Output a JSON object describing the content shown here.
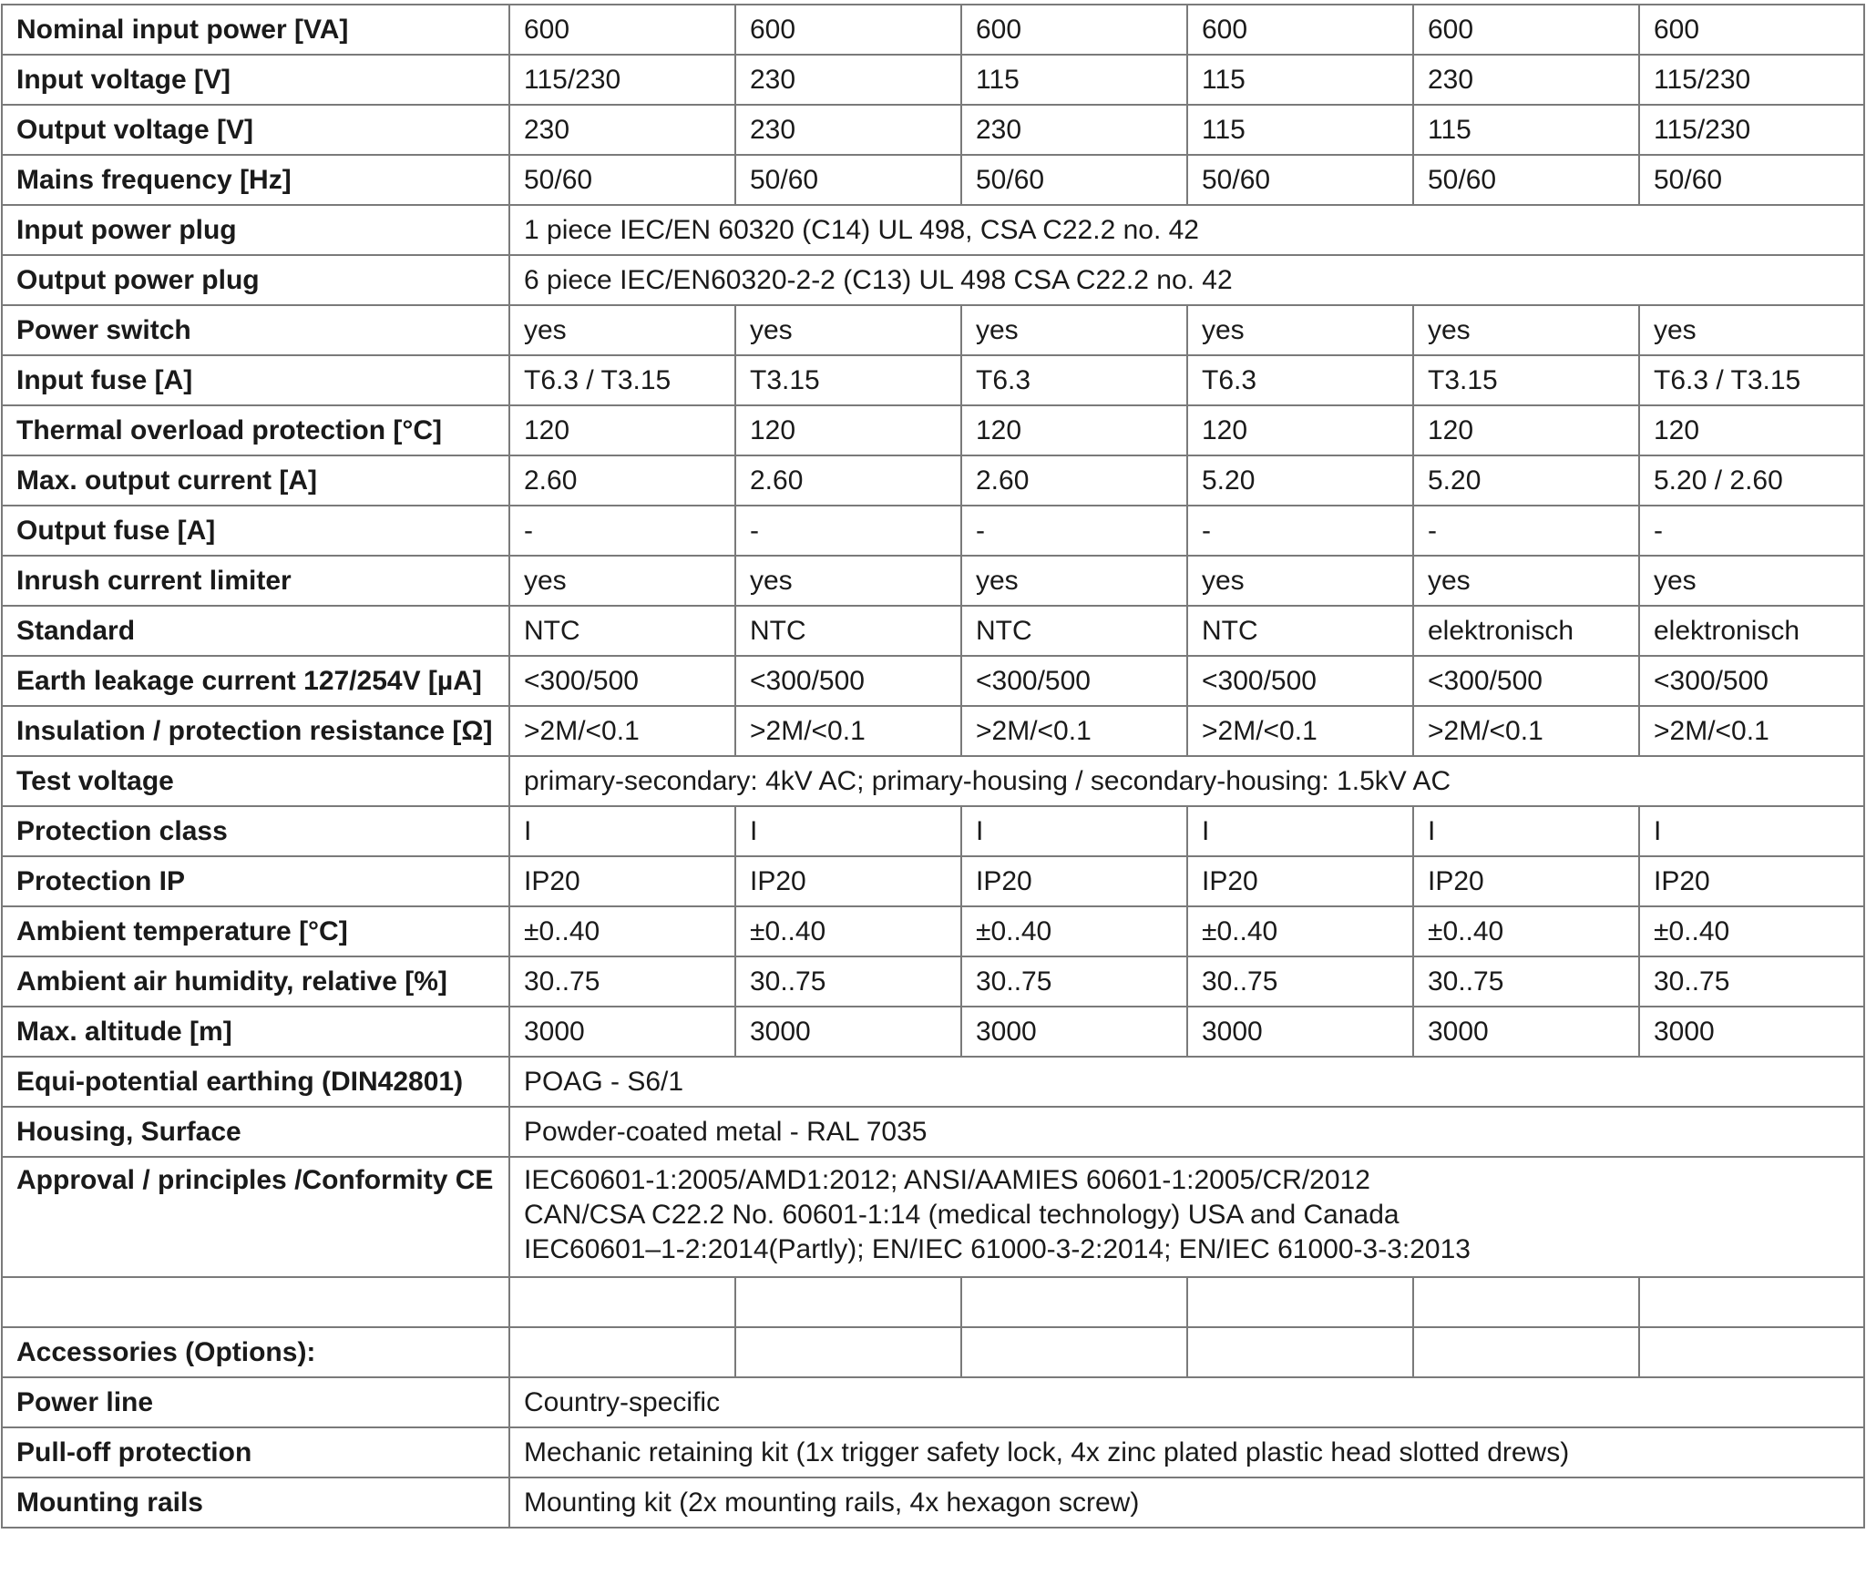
{
  "rows": [
    {
      "label": "Nominal input power [VA]",
      "cells": [
        "600",
        "600",
        "600",
        "600",
        "600",
        "600"
      ]
    },
    {
      "label": "Input voltage [V]",
      "cells": [
        "115/230",
        "230",
        "115",
        "115",
        "230",
        "115/230"
      ]
    },
    {
      "label": "Output voltage [V]",
      "cells": [
        "230",
        "230",
        "230",
        "115",
        "115",
        "115/230"
      ]
    },
    {
      "label": "Mains frequency [Hz]",
      "cells": [
        "50/60",
        "50/60",
        "50/60",
        "50/60",
        "50/60",
        "50/60"
      ]
    },
    {
      "label": "Input power plug",
      "span": "1 piece IEC/EN 60320 (C14) UL 498, CSA C22.2 no. 42"
    },
    {
      "label": "Output power plug",
      "span": "6 piece IEC/EN60320-2-2 (C13) UL 498 CSA C22.2 no. 42"
    },
    {
      "label": "Power switch",
      "cells": [
        "yes",
        "yes",
        "yes",
        "yes",
        "yes",
        "yes"
      ]
    },
    {
      "label": "Input fuse [A]",
      "cells": [
        "T6.3 / T3.15",
        "T3.15",
        "T6.3",
        "T6.3",
        "T3.15",
        "T6.3 / T3.15"
      ]
    },
    {
      "label": "Thermal overload protection [°C]",
      "cells": [
        "120",
        "120",
        "120",
        "120",
        "120",
        "120"
      ]
    },
    {
      "label": "Max. output current [A]",
      "cells": [
        "2.60",
        "2.60",
        "2.60",
        "5.20",
        "5.20",
        "5.20 / 2.60"
      ]
    },
    {
      "label": "Output fuse [A]",
      "cells": [
        "-",
        "-",
        "-",
        "-",
        "-",
        "-"
      ]
    },
    {
      "label": "Inrush current limiter",
      "cells": [
        "yes",
        "yes",
        "yes",
        "yes",
        "yes",
        "yes"
      ]
    },
    {
      "label": "Standard",
      "cells": [
        "NTC",
        "NTC",
        "NTC",
        "NTC",
        "elektronisch",
        "elektronisch"
      ]
    },
    {
      "label": "Earth leakage current 127/254V [µA]",
      "cells": [
        "<300/500",
        "<300/500",
        "<300/500",
        "<300/500",
        "<300/500",
        "<300/500"
      ]
    },
    {
      "label": "Insulation / protection resistance [Ω]",
      "cells": [
        ">2M/<0.1",
        ">2M/<0.1",
        ">2M/<0.1",
        ">2M/<0.1",
        ">2M/<0.1",
        ">2M/<0.1"
      ]
    },
    {
      "label": "Test voltage",
      "span": "primary-secondary: 4kV AC; primary-housing / secondary-housing: 1.5kV AC"
    },
    {
      "label": "Protection class",
      "cells": [
        "I",
        "I",
        "I",
        "I",
        "I",
        "I"
      ]
    },
    {
      "label": "Protection IP",
      "cells": [
        "IP20",
        "IP20",
        "IP20",
        "IP20",
        "IP20",
        "IP20"
      ]
    },
    {
      "label": "Ambient temperature [°C]",
      "cells": [
        "±0..40",
        "±0..40",
        "±0..40",
        "±0..40",
        "±0..40",
        "±0..40"
      ]
    },
    {
      "label": "Ambient air humidity, relative [%]",
      "cells": [
        "30..75",
        "30..75",
        "30..75",
        "30..75",
        "30..75",
        "30..75"
      ]
    },
    {
      "label": "Max. altitude [m]",
      "cells": [
        "3000",
        "3000",
        "3000",
        "3000",
        "3000",
        "3000"
      ]
    },
    {
      "label": "Equi-potential earthing (DIN42801)",
      "span": "POAG - S6/1"
    },
    {
      "label": "Housing, Surface",
      "span": "Powder-coated metal - RAL 7035"
    },
    {
      "label": "Approval / principles /Conformity CE",
      "tall": true,
      "lines": [
        "IEC60601-1:2005/AMD1:2012; ANSI/AAMIES 60601-1:2005/CR/2012",
        "CAN/CSA C22.2 No. 60601-1:14 (medical technology) USA and Canada",
        "IEC60601–1-2:2014(Partly); EN/IEC 61000-3-2:2014; EN/IEC 61000-3-3:2013"
      ]
    },
    {
      "label": "",
      "cells": [
        "",
        "",
        "",
        "",
        "",
        ""
      ]
    },
    {
      "label": "Accessories (Options):",
      "cells": [
        "",
        "",
        "",
        "",
        "",
        ""
      ]
    },
    {
      "label": "Power line",
      "span": "Country-specific"
    },
    {
      "label": "Pull-off protection",
      "span": "Mechanic retaining kit (1x trigger safety lock, 4x zinc plated plastic head slotted drews)"
    },
    {
      "label": "Mounting rails",
      "span": "Mounting kit (2x mounting rails, 4x hexagon screw)"
    }
  ]
}
